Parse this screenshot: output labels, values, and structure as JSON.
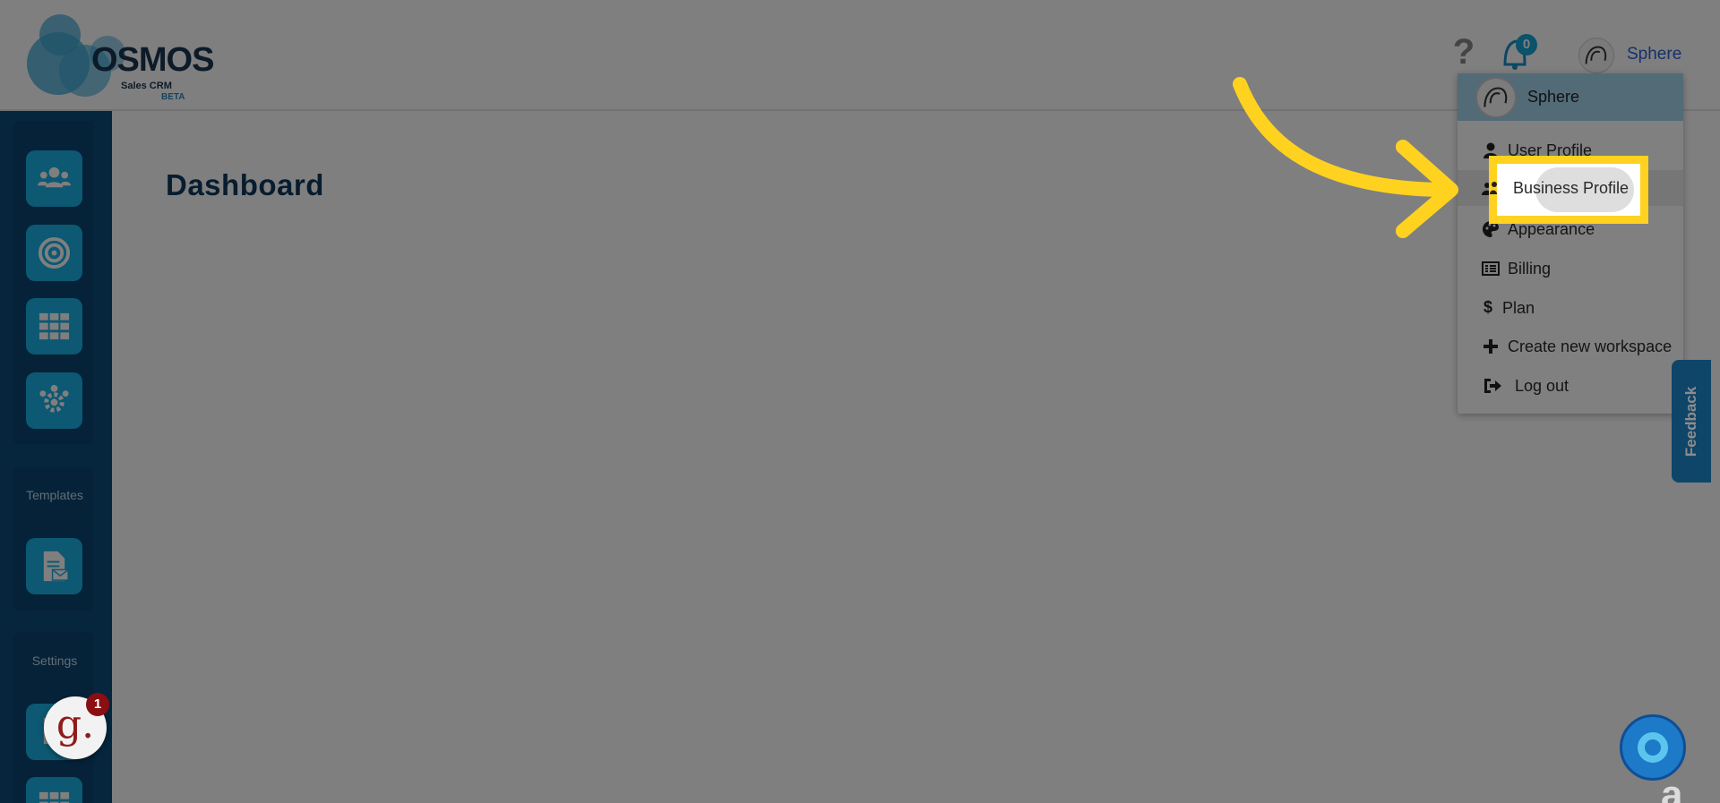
{
  "header": {
    "logo": {
      "brand": "OSMOS",
      "subtitle": "Sales CRM",
      "badge": "BETA"
    },
    "help_icon": "question-icon",
    "notifications": {
      "icon": "bell-icon",
      "count": "0"
    },
    "user": {
      "name": "Sphere"
    }
  },
  "sidebar": {
    "groups": [
      {
        "label": "",
        "items": [
          "users-icon",
          "target-icon",
          "grid-icon",
          "team-gear-icon"
        ]
      },
      {
        "label": "Templates",
        "items": [
          "email-template-icon"
        ]
      },
      {
        "label": "Settings",
        "items": [
          "settings-doc-icon",
          "grid-icon"
        ]
      }
    ]
  },
  "main": {
    "title": "Dashboard"
  },
  "dropdown": {
    "header_name": "Sphere",
    "items": [
      {
        "label": "User Profile",
        "icon": "user-icon"
      },
      {
        "label": "Business Profile",
        "icon": "business-icon"
      },
      {
        "label": "Appearance",
        "icon": "palette-icon"
      },
      {
        "label": "Billing",
        "icon": "list-icon"
      },
      {
        "label": "Plan",
        "icon": "dollar-icon"
      },
      {
        "label": "Create new workspace",
        "icon": "plus-icon"
      },
      {
        "label": "Log out",
        "icon": "logout-icon"
      }
    ]
  },
  "feedback": {
    "label": "Feedback"
  },
  "widgets": {
    "g_letter": "g.",
    "g_badge": "1"
  },
  "colors": {
    "sidebar": "#0b4d7a",
    "sidebar_button": "#1ab0e4",
    "highlight": "#ffd21f",
    "link": "#2d63d6",
    "title": "#0f3a5e"
  }
}
